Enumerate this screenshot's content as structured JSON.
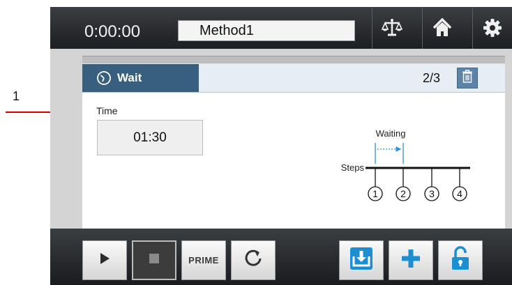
{
  "callout": {
    "number": "1"
  },
  "topbar": {
    "timer": "0:00:00",
    "method_name": "Method1",
    "icons": [
      "balance-icon",
      "home-icon",
      "gear-icon"
    ]
  },
  "step": {
    "title": "Wait",
    "counter": "2/3",
    "time_label": "Time",
    "time_value": "01:30"
  },
  "diagram": {
    "waiting_label": "Waiting",
    "steps_label": "Steps",
    "step_numbers": [
      "1",
      "2",
      "3",
      "4"
    ]
  },
  "bottombar": {
    "prime_label": "PRIME",
    "icons": [
      "play-icon",
      "stop-icon",
      "prime-button",
      "refresh-icon",
      "download-icon",
      "plus-icon",
      "unlock-icon"
    ]
  },
  "colors": {
    "accent": "#37607f",
    "blue_button": "#1c8fd0",
    "callout_arrow": "#d40000"
  }
}
